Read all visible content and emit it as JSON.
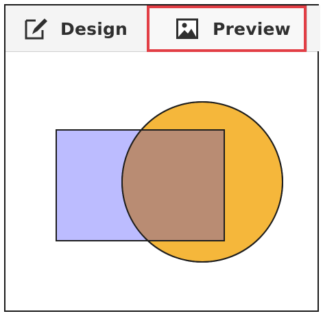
{
  "tabs": [
    {
      "label": "Design",
      "icon": "design-pencil-icon",
      "selected": false
    },
    {
      "label": "Preview",
      "icon": "image-icon",
      "selected": true,
      "highlight_color": "#e23e45"
    }
  ],
  "preview": {
    "shapes": [
      {
        "type": "rectangle",
        "fill": "#bcbcff",
        "stroke": "#1e1e1e"
      },
      {
        "type": "circle",
        "fill": "#f5b73b",
        "stroke": "#1e1e1e"
      },
      {
        "type": "overlap",
        "fill": "#b98c73"
      }
    ]
  }
}
